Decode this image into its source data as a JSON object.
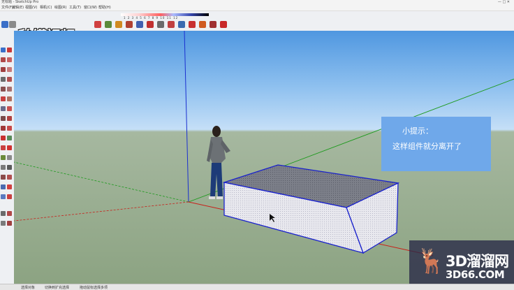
{
  "app": {
    "title": "无标题 - SketchUp Pro",
    "window_buttons": "— □ ✕"
  },
  "menu": [
    "文件(F)",
    "编辑(E)",
    "视图(V)",
    "相机(C)",
    "绘图(R)",
    "工具(T)",
    "窗口(W)",
    "帮助(H)"
  ],
  "palette_numbers": "1 2 3 4 5 6 7 8 9 10 11 12",
  "logo_text": "秒懂视频",
  "tip": {
    "heading": "小提示：",
    "body": "这样组件就分离开了"
  },
  "watermark": {
    "name": "3D溜溜网",
    "site": "3D66.COM"
  },
  "status": {
    "left": "选择对象",
    "mid": "切换到扩充选择",
    "right": "拖动鼠标选择多项"
  },
  "colors": {
    "axis_red": "#c8201a",
    "axis_green": "#1c9a1c",
    "axis_blue": "#1a2fd0",
    "tip_bg": "#6fa8ea",
    "box_edge": "#1a22cc"
  },
  "icons": {
    "toolbar": [
      "select-icon",
      "eraser-icon",
      "paint-icon",
      "line-icon",
      "arc-icon",
      "rectangle-icon",
      "pushpull-icon",
      "move-icon",
      "rotate-icon",
      "scale-icon",
      "offset-icon",
      "tape-icon",
      "text-icon",
      "orbit-icon",
      "pan-icon",
      "zoom-icon",
      "zoom-extents-icon",
      "walk-icon",
      "component-icon",
      "ruby-icon"
    ],
    "left_toolbar": [
      "select-icon",
      "component-icon",
      "paint-icon",
      "eraser-icon",
      "line-icon",
      "freehand-icon",
      "arc-icon",
      "rectangle-icon",
      "circle-icon",
      "polygon-icon",
      "pushpull-icon",
      "followme-icon",
      "offset-icon",
      "move-icon",
      "rotate-icon",
      "scale-icon",
      "tape-icon",
      "protractor-icon",
      "dimension-icon",
      "text-icon",
      "axes-icon",
      "3dtext-icon",
      "orbit-icon",
      "pan-icon",
      "zoom-icon",
      "zoomwindow-icon",
      "zoomextents-icon",
      "walk-icon",
      "lookaround-icon",
      "section-icon",
      "position-camera-icon",
      "sandbox-icon",
      "warehouse-icon",
      "extension-icon",
      "layer-icon",
      "style-icon",
      "scene-icon"
    ]
  }
}
